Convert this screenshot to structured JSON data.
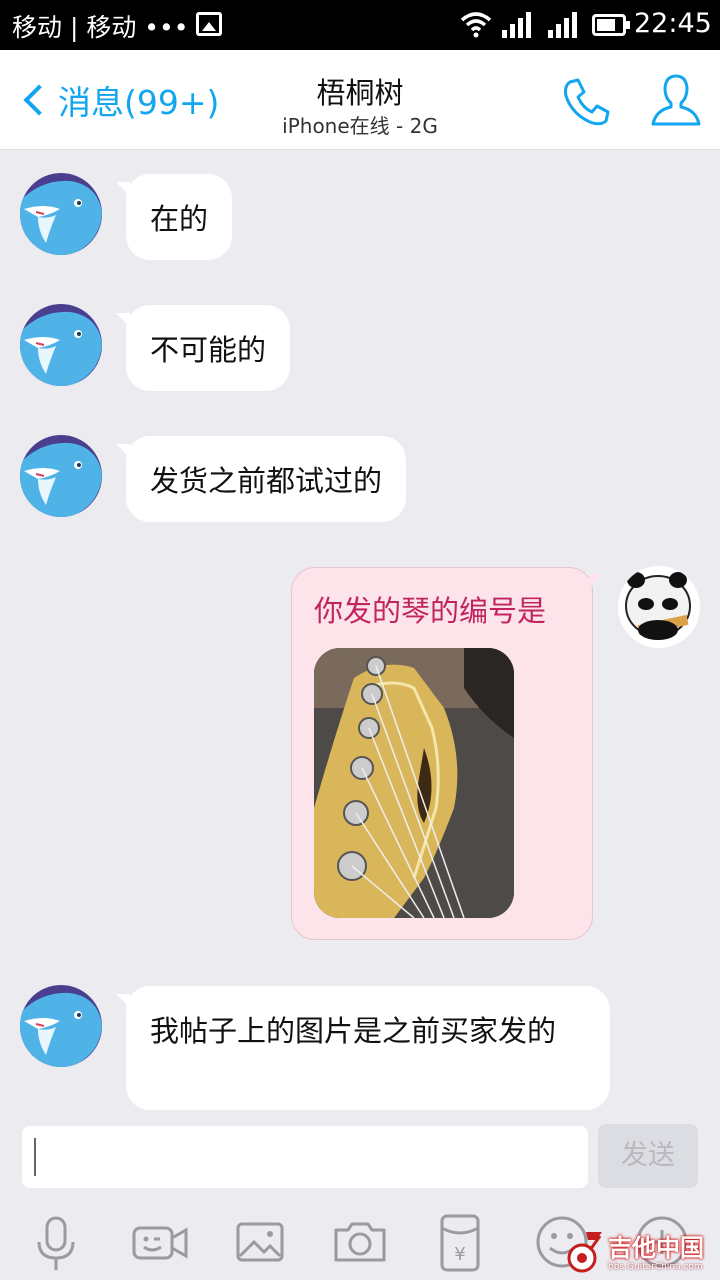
{
  "status_bar": {
    "carrier": "移动 | 移动 •••",
    "time": "22:45"
  },
  "header": {
    "back_label": "消息(99+)",
    "contact_name": "梧桐树",
    "contact_status": "iPhone在线 - 2G"
  },
  "messages": [
    {
      "side": "left",
      "text": "在的"
    },
    {
      "side": "left",
      "text": "不可能的"
    },
    {
      "side": "left",
      "text": "发货之前都试过的"
    },
    {
      "side": "right",
      "text": "你发的琴的编号是",
      "has_image": true
    },
    {
      "side": "left",
      "text": "我帖子上的图片是之前买家发的"
    }
  ],
  "input": {
    "placeholder": "",
    "send_label": "发送"
  },
  "toolbar": [
    "microphone-icon",
    "video-call-icon",
    "image-icon",
    "camera-icon",
    "red-packet-icon",
    "emoji-icon",
    "more-icon"
  ],
  "watermark": {
    "title": "吉他中国",
    "url": "bbs.GuitarChina.com"
  },
  "colors": {
    "accent": "#12a5f0",
    "sent_bubble": "#fde3ea",
    "sent_text": "#c0255f",
    "background": "#ebebf0"
  }
}
